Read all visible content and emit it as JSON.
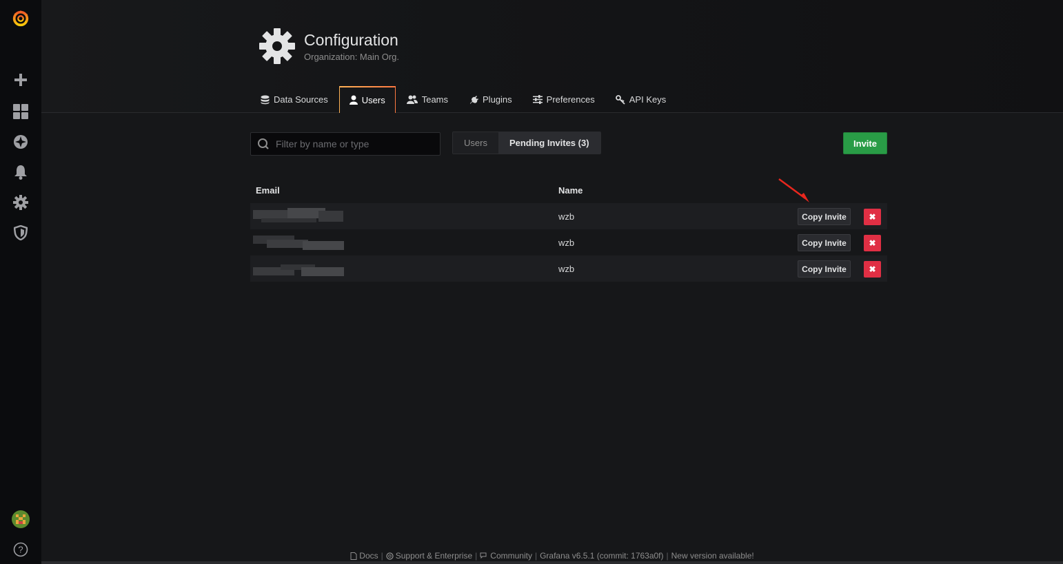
{
  "page": {
    "title": "Configuration",
    "subtitle": "Organization: Main Org."
  },
  "tabs": [
    {
      "label": "Data Sources",
      "icon": "database-icon"
    },
    {
      "label": "Users",
      "icon": "user-icon",
      "active": true
    },
    {
      "label": "Teams",
      "icon": "users-icon"
    },
    {
      "label": "Plugins",
      "icon": "plug-icon"
    },
    {
      "label": "Preferences",
      "icon": "sliders-icon"
    },
    {
      "label": "API Keys",
      "icon": "key-icon"
    }
  ],
  "search": {
    "placeholder": "Filter by name or type"
  },
  "view_toggle": {
    "users_label": "Users",
    "pending_label": "Pending Invites (3)"
  },
  "invite_button": "Invite",
  "table": {
    "headers": {
      "email": "Email",
      "name": "Name"
    },
    "rows": [
      {
        "name": "wzb",
        "copy_label": "Copy Invite",
        "delete_label": "✖"
      },
      {
        "name": "wzb",
        "copy_label": "Copy Invite",
        "delete_label": "✖"
      },
      {
        "name": "wzb",
        "copy_label": "Copy Invite",
        "delete_label": "✖"
      }
    ]
  },
  "footer": {
    "docs": "Docs",
    "support": "Support & Enterprise",
    "community": "Community",
    "version": "Grafana v6.5.1 (commit: 1763a0f)",
    "update": "New version available!"
  },
  "colors": {
    "accent_orange": "#ff7941",
    "invite_green": "#299c46",
    "delete_red": "#e02f44",
    "arrow_red": "#e8271e"
  }
}
